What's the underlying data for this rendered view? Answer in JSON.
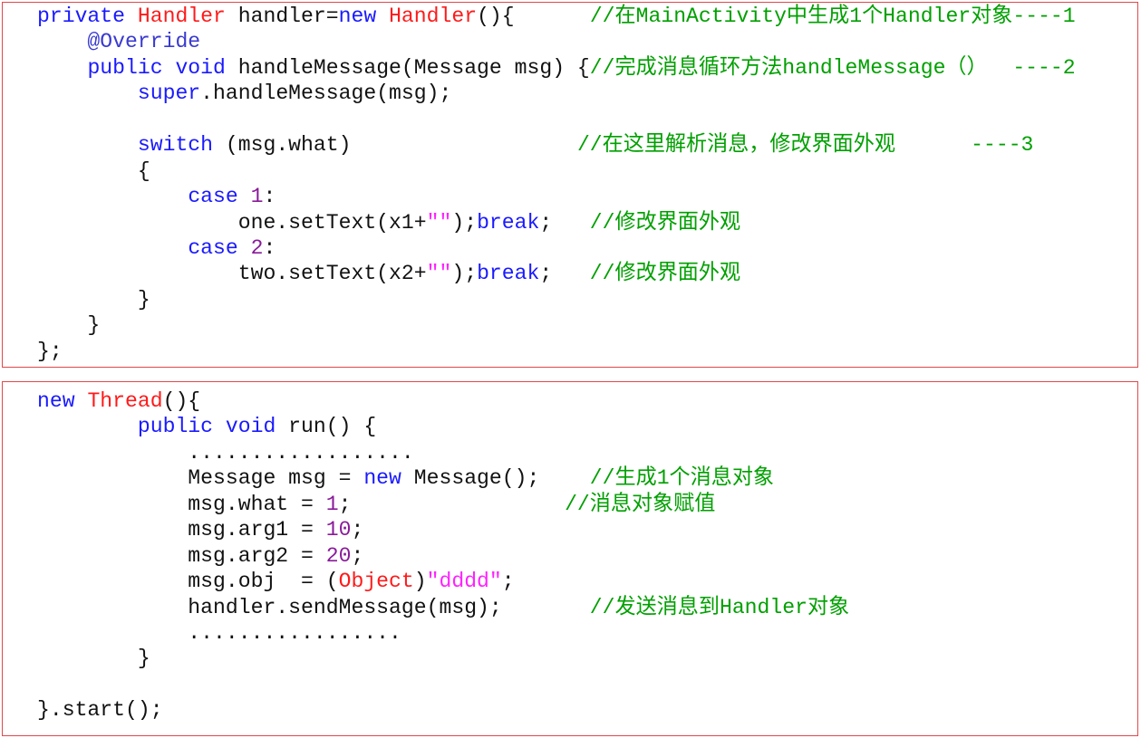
{
  "colors": {
    "border": "#e0484a",
    "keyword": "#1a1aff",
    "type": "#ff1a1a",
    "comment": "#00a000",
    "number": "#8a1a9a",
    "string": "#ff22ff"
  },
  "blocks": [
    {
      "name": "handler-block",
      "lines": [
        [
          [
            "kw",
            "private "
          ],
          [
            "ty",
            "Handler"
          ],
          [
            "pl",
            " handler="
          ],
          [
            "kw",
            "new "
          ],
          [
            "ty",
            "Handler"
          ],
          [
            "pl",
            "(){      "
          ],
          [
            "cm",
            "//在MainActivity中生成1个Handler对象----1"
          ]
        ],
        [
          [
            "an",
            "    @Override"
          ]
        ],
        [
          [
            "pl",
            "    "
          ],
          [
            "kw",
            "public void"
          ],
          [
            "pl",
            " handleMessage(Message msg) {"
          ],
          [
            "cm",
            "//完成消息循环方法handleMessage（）  ----2"
          ]
        ],
        [
          [
            "pl",
            "        "
          ],
          [
            "kw",
            "super"
          ],
          [
            "pl",
            ".handleMessage(msg);"
          ]
        ],
        [
          [
            "pl",
            ""
          ]
        ],
        [
          [
            "pl",
            "        "
          ],
          [
            "kw",
            "switch"
          ],
          [
            "pl",
            " (msg.what)                  "
          ],
          [
            "cm",
            "//在这里解析消息，修改界面外观      ----3"
          ]
        ],
        [
          [
            "pl",
            "        {"
          ]
        ],
        [
          [
            "pl",
            "            "
          ],
          [
            "kw",
            "case "
          ],
          [
            "num",
            "1"
          ],
          [
            "pl",
            ":"
          ]
        ],
        [
          [
            "pl",
            "                one.setText(x1+"
          ],
          [
            "str",
            "\"\""
          ],
          [
            "pl",
            ");"
          ],
          [
            "kw",
            "break"
          ],
          [
            "pl",
            ";   "
          ],
          [
            "cm",
            "//修改界面外观"
          ]
        ],
        [
          [
            "pl",
            "            "
          ],
          [
            "kw",
            "case "
          ],
          [
            "num",
            "2"
          ],
          [
            "pl",
            ":"
          ]
        ],
        [
          [
            "pl",
            "                two.setText(x2+"
          ],
          [
            "str",
            "\"\""
          ],
          [
            "pl",
            ");"
          ],
          [
            "kw",
            "break"
          ],
          [
            "pl",
            ";   "
          ],
          [
            "cm",
            "//修改界面外观"
          ]
        ],
        [
          [
            "pl",
            "        }"
          ]
        ],
        [
          [
            "pl",
            "    }"
          ]
        ],
        [
          [
            "pl",
            "};"
          ]
        ]
      ]
    },
    {
      "name": "thread-block",
      "lines": [
        [
          [
            "kw",
            "new "
          ],
          [
            "ty",
            "Thread"
          ],
          [
            "pl",
            "(){"
          ]
        ],
        [
          [
            "pl",
            "        "
          ],
          [
            "kw",
            "public void"
          ],
          [
            "pl",
            " run() {"
          ]
        ],
        [
          [
            "pl",
            "            .................."
          ]
        ],
        [
          [
            "pl",
            "            Message msg = "
          ],
          [
            "kw",
            "new"
          ],
          [
            "pl",
            " Message();    "
          ],
          [
            "cm",
            "//生成1个消息对象"
          ]
        ],
        [
          [
            "pl",
            "            msg.what = "
          ],
          [
            "num",
            "1"
          ],
          [
            "pl",
            ";                 "
          ],
          [
            "cm",
            "//消息对象赋值"
          ]
        ],
        [
          [
            "pl",
            "            msg.arg1 = "
          ],
          [
            "num",
            "10"
          ],
          [
            "pl",
            ";"
          ]
        ],
        [
          [
            "pl",
            "            msg.arg2 = "
          ],
          [
            "num",
            "20"
          ],
          [
            "pl",
            ";"
          ]
        ],
        [
          [
            "pl",
            "            msg.obj  = ("
          ],
          [
            "ty",
            "Object"
          ],
          [
            "pl",
            ")"
          ],
          [
            "str",
            "\"dddd\""
          ],
          [
            "pl",
            ";"
          ]
        ],
        [
          [
            "pl",
            "            handler.sendMessage(msg);       "
          ],
          [
            "cm",
            "//发送消息到Handler对象"
          ]
        ],
        [
          [
            "pl",
            "            ................."
          ]
        ],
        [
          [
            "pl",
            "        }"
          ]
        ],
        [
          [
            "pl",
            ""
          ]
        ],
        [
          [
            "pl",
            "}.start();"
          ]
        ]
      ]
    }
  ]
}
